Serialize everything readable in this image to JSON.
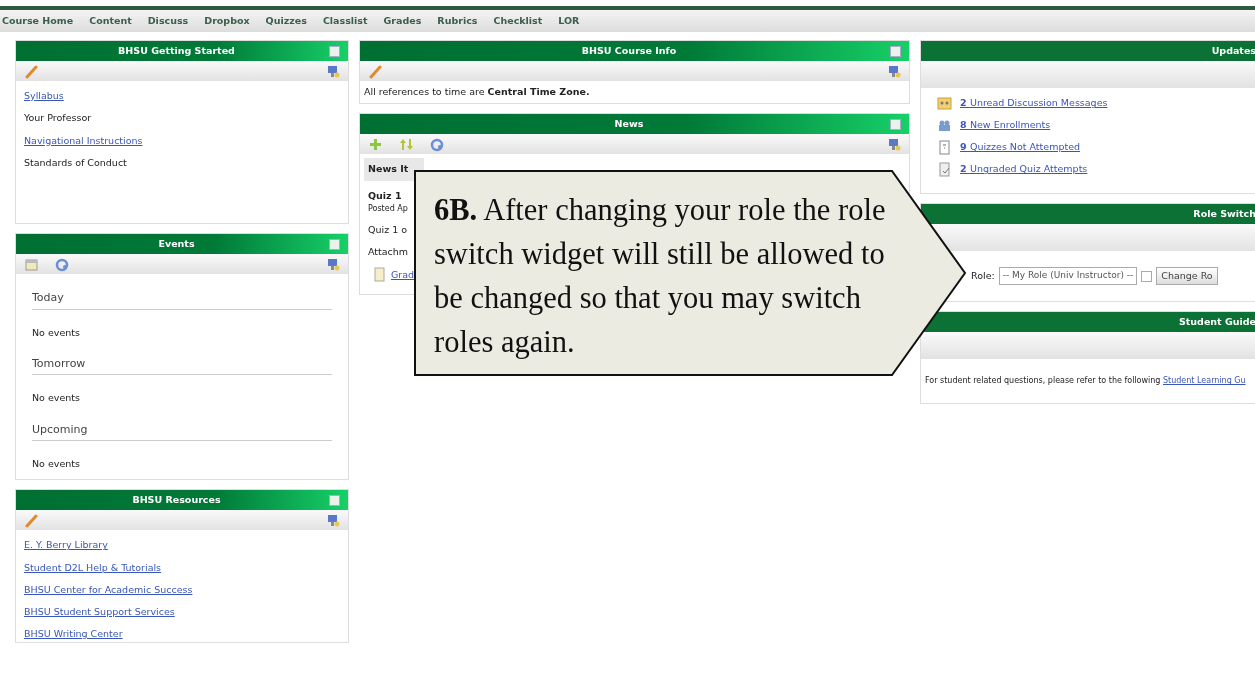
{
  "nav": [
    "Course Home",
    "Content",
    "Discuss",
    "Dropbox",
    "Quizzes",
    "Classlist",
    "Grades",
    "Rubrics",
    "Checklist",
    "LOR"
  ],
  "columns": [
    {
      "widgets": [
        {
          "kind": "links",
          "title": "BHSU Getting Started",
          "items": [
            {
              "text": "Syllabus",
              "link": true
            },
            {
              "text": "Your Professor",
              "link": false
            },
            {
              "text": "Navigational Instructions",
              "link": true
            },
            {
              "text": "Standards of Conduct",
              "link": false
            }
          ]
        },
        {
          "kind": "events",
          "title": "Events",
          "sections": [
            {
              "heading": "Today",
              "text": "No events"
            },
            {
              "heading": "Tomorrow",
              "text": "No events"
            },
            {
              "heading": "Upcoming",
              "text": "No events"
            }
          ]
        },
        {
          "kind": "links",
          "title": "BHSU Resources",
          "items": [
            {
              "text": "E. Y. Berry Library",
              "link": true
            },
            {
              "text": "Student D2L Help & Tutorials",
              "link": true
            },
            {
              "text": "BHSU Center for Academic Success",
              "link": true
            },
            {
              "text": "BHSU Student Support Services",
              "link": true
            },
            {
              "text": "BHSU Writing Center",
              "link": true
            }
          ]
        }
      ]
    },
    {
      "widgets": [
        {
          "kind": "text",
          "title": "BHSU Course Info",
          "text": "All references to time are **Central Time Zone.**"
        },
        {
          "kind": "news",
          "title": "News",
          "heading": "News It",
          "item_title": "Quiz 1",
          "posted": "Posted Ap",
          "body": "Quiz 1 o",
          "attachments": "Attachm",
          "attachment": "Grad"
        }
      ]
    },
    {
      "widgets": [
        {
          "kind": "updates",
          "title": "Updates",
          "items": [
            {
              "kind": "messages",
              "count": "2",
              "text": "Unread Discussion Messages"
            },
            {
              "kind": "enrollments",
              "count": "8",
              "text": "New Enrollments"
            },
            {
              "kind": "quizzes",
              "count": "9",
              "text": "Quizzes Not Attempted"
            },
            {
              "kind": "attempts",
              "count": "2",
              "text": "Ungraded Quiz Attempts"
            }
          ]
        },
        {
          "kind": "role",
          "title": "Role Switch",
          "label": "Role:",
          "value": "-- My Role (Univ Instructor) --",
          "button": "Change Ro"
        },
        {
          "kind": "guides",
          "title": "Student Guide",
          "text": "For student related questions, please refer to the following",
          "link": "Student Learning Gu"
        }
      ]
    }
  ],
  "callout": "**6B.** After changing your role the role switch widget will still be allowed to be changed so that you may switch roles again."
}
